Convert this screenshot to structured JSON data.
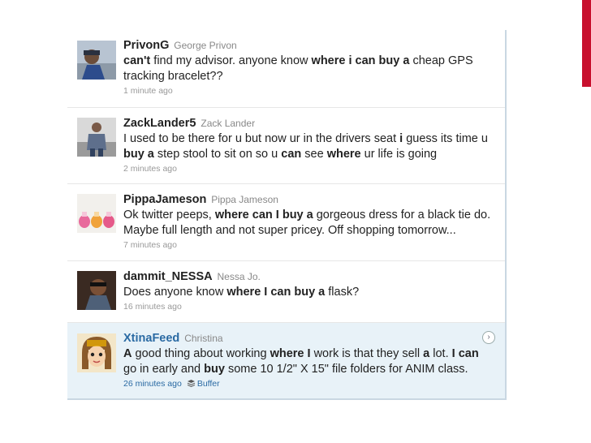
{
  "tweets": [
    {
      "username": "PrivonG",
      "realname": "George Privon",
      "segments": [
        {
          "t": "can't",
          "b": true
        },
        {
          "t": " find my advisor. anyone know "
        },
        {
          "t": "where i can buy a",
          "b": true
        },
        {
          "t": " cheap GPS tracking bracelet??"
        }
      ],
      "time": "1 minute ago"
    },
    {
      "username": "ZackLander5",
      "realname": "Zack Lander",
      "segments": [
        {
          "t": "I used to be there for u but now ur in the drivers seat "
        },
        {
          "t": "i",
          "b": true
        },
        {
          "t": " guess its time u "
        },
        {
          "t": "buy a",
          "b": true
        },
        {
          "t": " step stool to sit on so u "
        },
        {
          "t": "can",
          "b": true
        },
        {
          "t": " see "
        },
        {
          "t": "where",
          "b": true
        },
        {
          "t": " ur life is going"
        }
      ],
      "time": "2 minutes ago"
    },
    {
      "username": "PippaJameson",
      "realname": "Pippa Jameson",
      "segments": [
        {
          "t": "Ok twitter peeps, "
        },
        {
          "t": "where can I buy a",
          "b": true
        },
        {
          "t": " gorgeous dress for a black tie do. Maybe full length and not super pricey. Off shopping tomorrow..."
        }
      ],
      "time": "7 minutes ago"
    },
    {
      "username": "dammit_NESSA",
      "realname": "Nessa Jo.",
      "segments": [
        {
          "t": "Does anyone know "
        },
        {
          "t": "where I can buy a",
          "b": true
        },
        {
          "t": " flask?"
        }
      ],
      "time": "16 minutes ago"
    },
    {
      "username": "XtinaFeed",
      "realname": "Christina",
      "segments": [
        {
          "t": "A",
          "b": true
        },
        {
          "t": " good thing about working "
        },
        {
          "t": "where I",
          "b": true
        },
        {
          "t": " work is that they sell "
        },
        {
          "t": "a",
          "b": true
        },
        {
          "t": " lot. "
        },
        {
          "t": "I can",
          "b": true
        },
        {
          "t": " go in early and "
        },
        {
          "t": "buy",
          "b": true
        },
        {
          "t": " some 10 1/2\" X 15\" file folders for ANIM class."
        }
      ],
      "time": "26 minutes ago",
      "buffer_label": "Buffer",
      "highlighted": true
    }
  ],
  "colors": {
    "accent": "#c8102e",
    "link": "#2a6aa3",
    "highlight_bg": "#e8f2f8"
  }
}
